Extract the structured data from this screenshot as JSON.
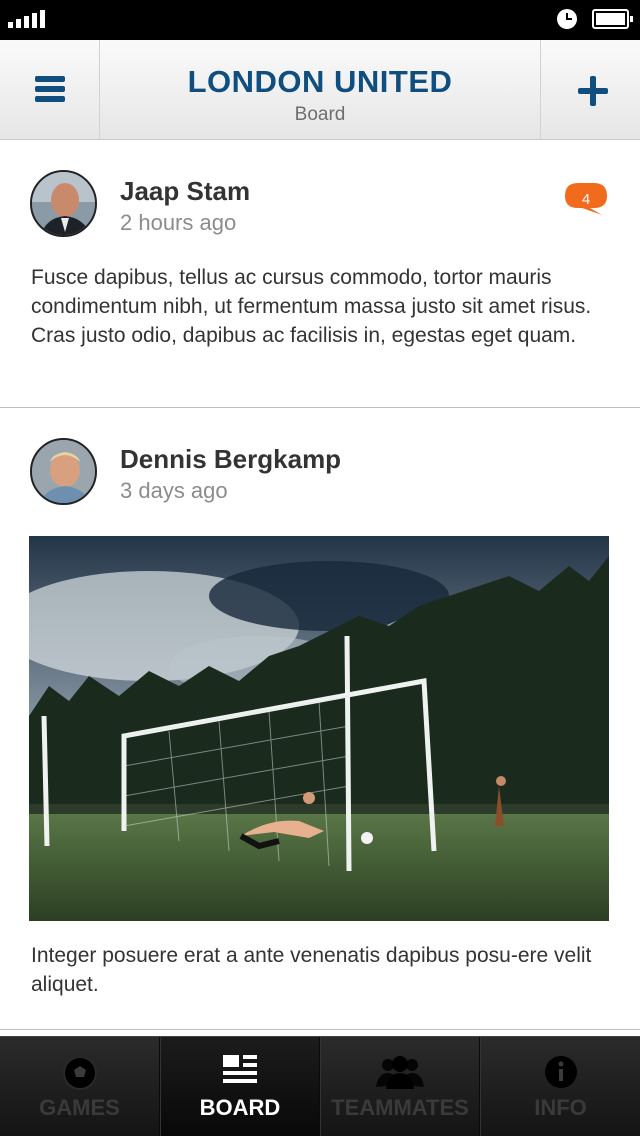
{
  "header": {
    "title": "LONDON UNITED",
    "subtitle": "Board"
  },
  "colors": {
    "brand": "#0f4e7e",
    "badge": "#f26b1d",
    "tab_bar": "#1b1b1b"
  },
  "posts": [
    {
      "author": "Jaap Stam",
      "time": "2 hours ago",
      "comment_count": "4",
      "text": "Fusce dapibus, tellus ac cursus commodo, tortor mauris condimentum nibh, ut fermentum massa justo sit amet risus. Cras justo odio, dapibus ac facilisis in, egestas eget quam."
    },
    {
      "author": "Dennis Bergkamp",
      "time": "3 days ago",
      "text": "Integer posuere erat a ante venenatis dapibus posu-ere velit aliquet."
    }
  ],
  "tabs": [
    {
      "label": "GAMES",
      "icon": "soccer-ball-icon",
      "active": false
    },
    {
      "label": "BOARD",
      "icon": "board-icon",
      "active": true
    },
    {
      "label": "TEAMMATES",
      "icon": "teammates-icon",
      "active": false
    },
    {
      "label": "INFO",
      "icon": "info-icon",
      "active": false
    }
  ]
}
